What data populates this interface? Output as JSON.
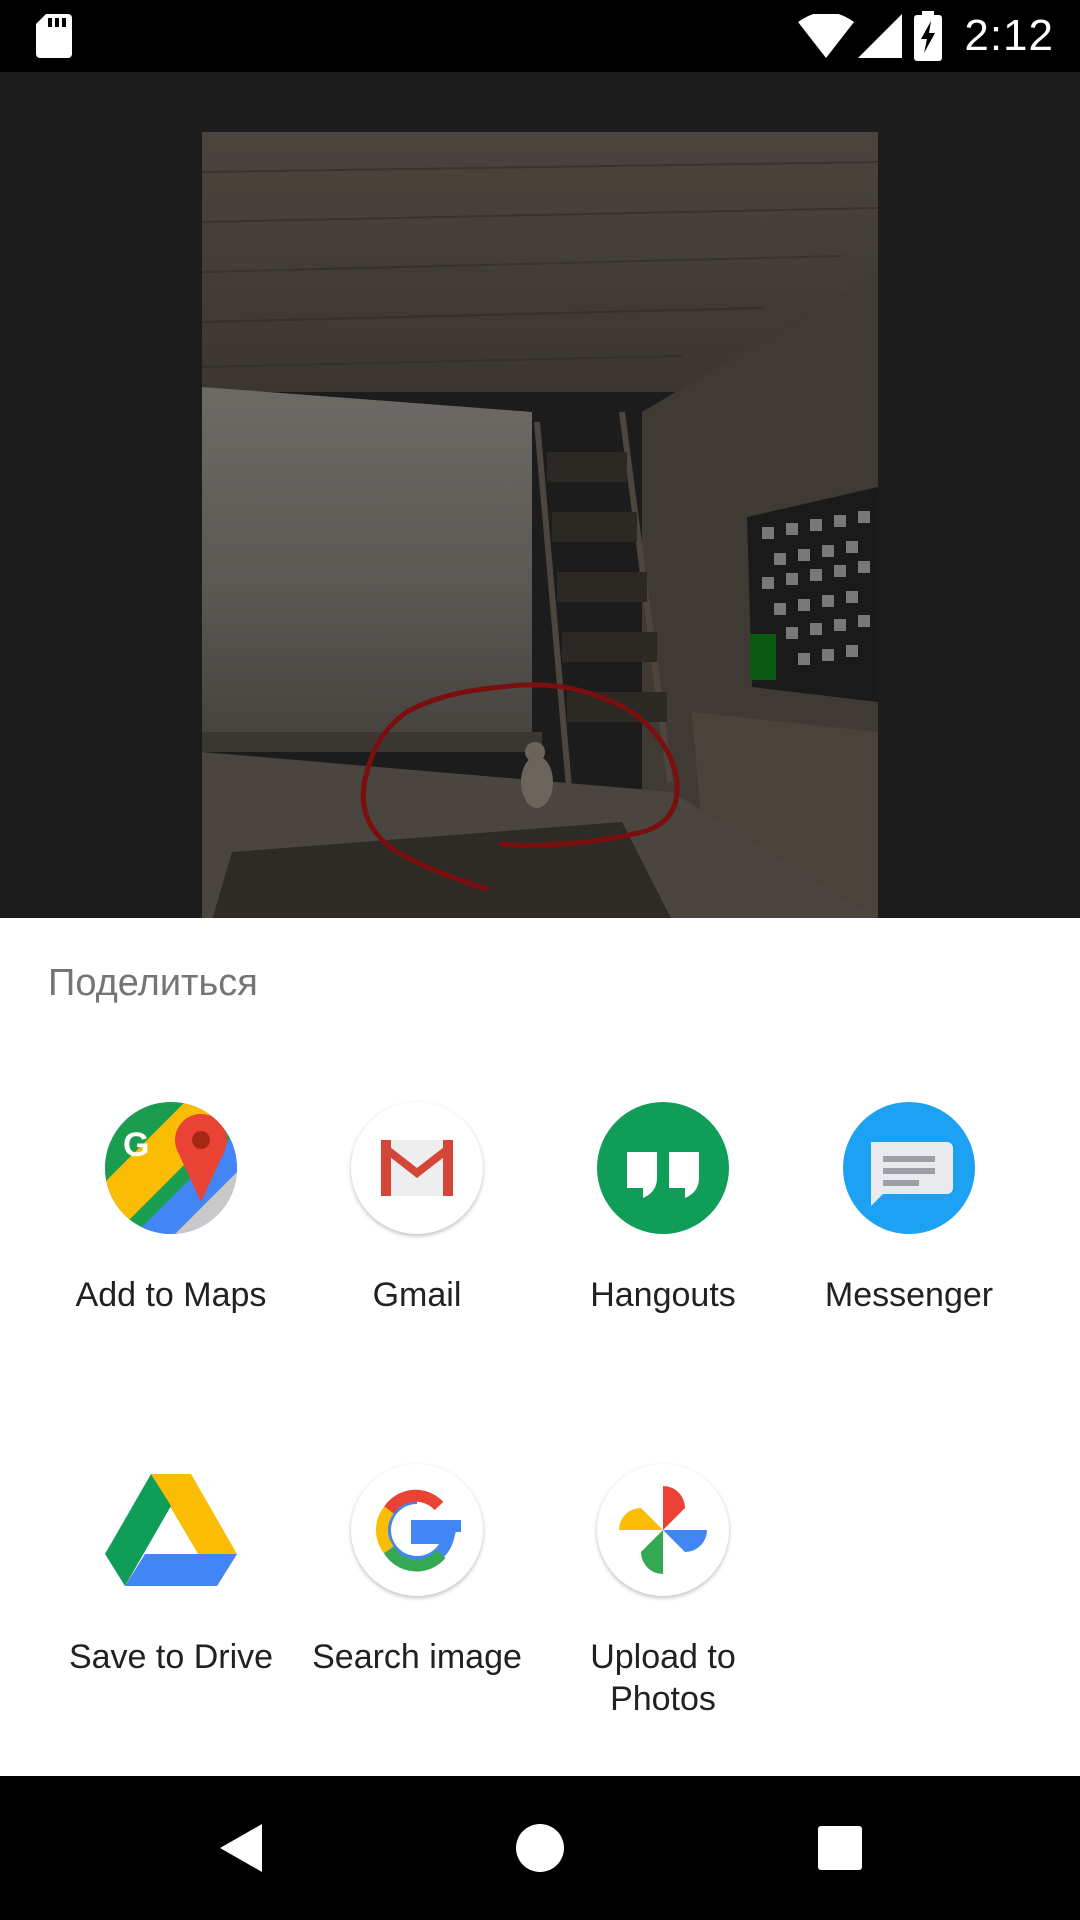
{
  "status_bar": {
    "time": "2:12",
    "icons": [
      "sd-card-icon",
      "wifi-icon",
      "signal-icon",
      "battery-charging-icon"
    ]
  },
  "share_sheet": {
    "title": "Поделиться",
    "apps": [
      {
        "label": "Add to Maps",
        "icon": "google-maps-icon"
      },
      {
        "label": "Gmail",
        "icon": "gmail-icon"
      },
      {
        "label": "Hangouts",
        "icon": "hangouts-icon"
      },
      {
        "label": "Messenger",
        "icon": "messenger-icon"
      },
      {
        "label": "Save to Drive",
        "icon": "google-drive-icon"
      },
      {
        "label": "Search image",
        "icon": "google-icon"
      },
      {
        "label": "Upload to\nPhotos",
        "icon": "google-photos-icon"
      }
    ]
  },
  "nav_bar": {
    "buttons": [
      "back-icon",
      "home-icon",
      "recents-icon"
    ]
  },
  "colors": {
    "sheet_background": "#ffffff",
    "dimmed_background": "#1c1c1c",
    "annotation_stroke": "#7a0f0f",
    "hangouts_green": "#0f9d58",
    "messenger_blue": "#1da1f2"
  }
}
